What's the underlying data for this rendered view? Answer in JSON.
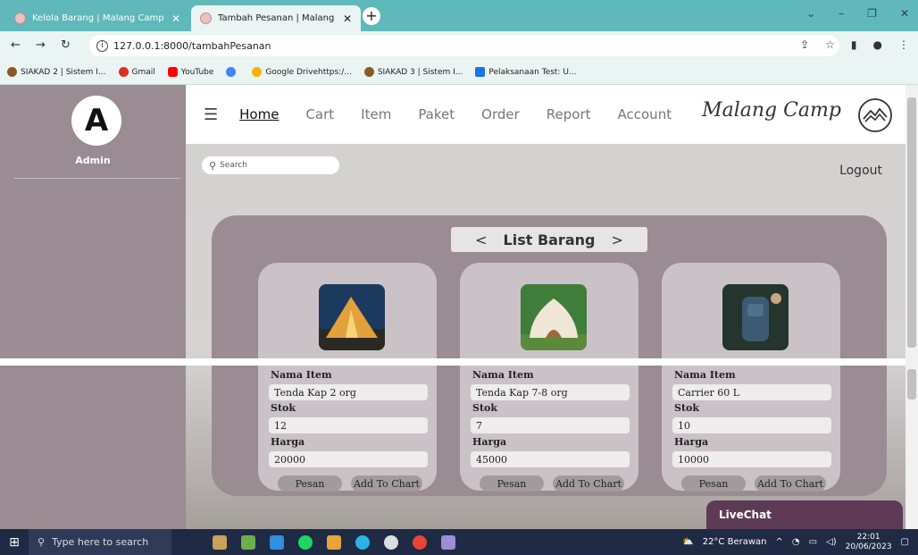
{
  "browser": {
    "tabs": [
      {
        "label": "Kelola Barang | Malang Camp",
        "active": false
      },
      {
        "label": "Tambah Pesanan | Malang Camp",
        "active": true
      }
    ],
    "url": "127.0.0.1:8000/tambahPesanan",
    "bookmarks": [
      {
        "label": "SIAKAD 2 | Sistem I...",
        "color": "#8b5a2b"
      },
      {
        "label": "Gmail",
        "color": "#d93025"
      },
      {
        "label": "YouTube",
        "color": "#ff0000"
      },
      {
        "label": "",
        "color": "#4285f4"
      },
      {
        "label": "Google Drivehttps:/...",
        "color": "#f4b400"
      },
      {
        "label": "SIAKAD 3 | Sistem I...",
        "color": "#8b5a2b"
      },
      {
        "label": "Pelaksanaan Test: U...",
        "color": "#1a73e8"
      }
    ]
  },
  "sidebar": {
    "logo_glyph": "A",
    "role": "Admin"
  },
  "nav": {
    "items": [
      "Home",
      "Cart",
      "Item",
      "Paket",
      "Order",
      "Report",
      "Account"
    ],
    "brand": "Malang Camp"
  },
  "search": {
    "placeholder": "Search"
  },
  "logout": "Logout",
  "list": {
    "prev": "<",
    "title": "List Barang",
    "next": ">",
    "labels": {
      "name": "Nama Item",
      "stock": "Stok",
      "price": "Harga"
    },
    "buttons": {
      "order": "Pesan",
      "add": "Add To Chart"
    },
    "items": [
      {
        "name": "Tenda Kap 2 org",
        "stock": "12",
        "price": "20000"
      },
      {
        "name": "Tenda Kap 7-8 org",
        "stock": "7",
        "price": "45000"
      },
      {
        "name": "Carrier 60 L",
        "stock": "10",
        "price": "10000"
      }
    ]
  },
  "livechat": "LiveChat",
  "taskbar": {
    "search_placeholder": "Type here to search",
    "weather": "22°C  Berawan",
    "time": "22:01",
    "date": "20/06/2023"
  },
  "colors": {
    "sidebar": "#9b8b93",
    "card": "#cbc2c8",
    "livechat": "#5d3b57",
    "tabbar": "#5fb8ba"
  }
}
